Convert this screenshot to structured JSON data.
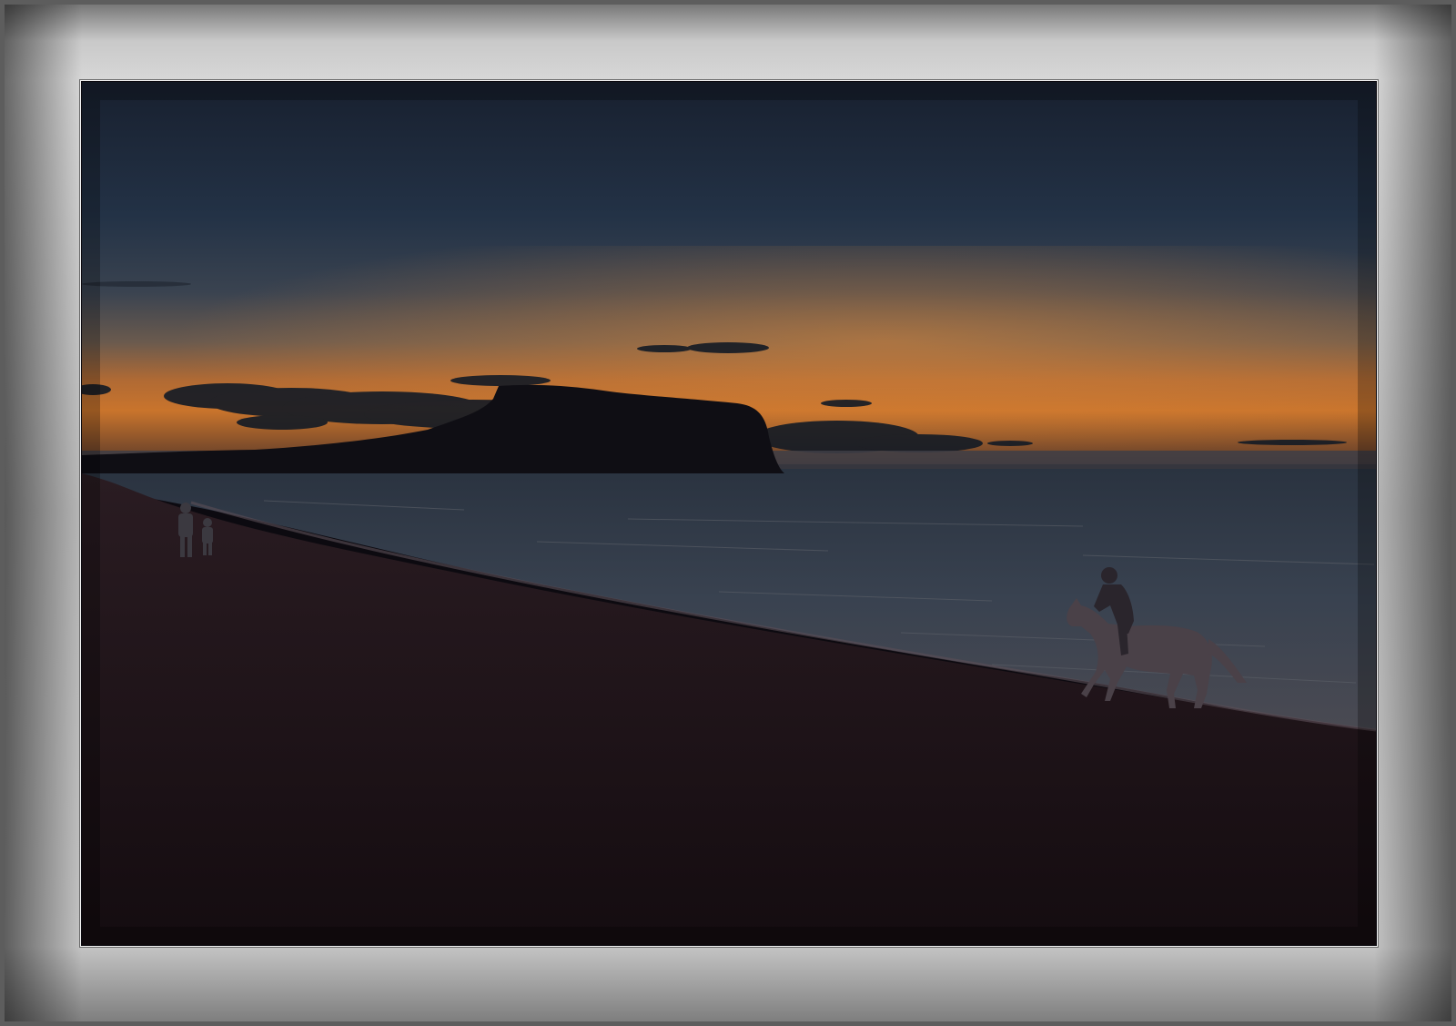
{
  "image": {
    "description_tag": "photo",
    "colors": {
      "sky_top": "#1a2436",
      "sky_mid": "#2c3a4c",
      "horizon_glow": "#c9742c",
      "sea": "#2b3440",
      "sand": "#1c1216",
      "frame": "#c8c8c8"
    }
  }
}
